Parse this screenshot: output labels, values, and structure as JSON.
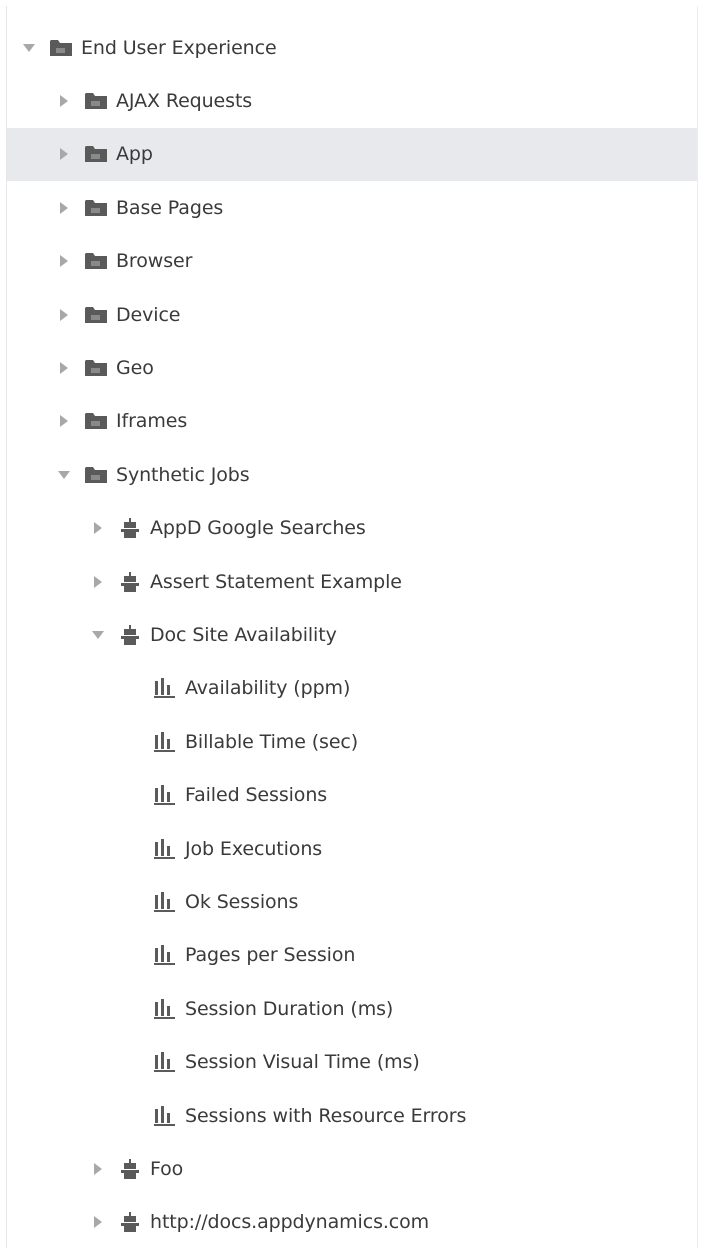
{
  "tree": {
    "root": {
      "label": "End User Experience",
      "expanded": true,
      "icon": "folder-icon"
    },
    "folders": [
      {
        "label": "AJAX Requests",
        "expanded": false,
        "selected": false,
        "icon": "folder-icon"
      },
      {
        "label": "App",
        "expanded": false,
        "selected": true,
        "icon": "folder-icon"
      },
      {
        "label": "Base Pages",
        "expanded": false,
        "selected": false,
        "icon": "folder-icon"
      },
      {
        "label": "Browser",
        "expanded": false,
        "selected": false,
        "icon": "folder-icon"
      },
      {
        "label": "Device",
        "expanded": false,
        "selected": false,
        "icon": "folder-icon"
      },
      {
        "label": "Geo",
        "expanded": false,
        "selected": false,
        "icon": "folder-icon"
      },
      {
        "label": "Iframes",
        "expanded": false,
        "selected": false,
        "icon": "folder-icon"
      },
      {
        "label": "Synthetic Jobs",
        "expanded": true,
        "selected": false,
        "icon": "folder-icon"
      }
    ],
    "jobs": [
      {
        "label": "AppD Google Searches",
        "expanded": false,
        "icon": "robot-icon"
      },
      {
        "label": "Assert Statement Example",
        "expanded": false,
        "icon": "robot-icon"
      },
      {
        "label": "Doc Site Availability",
        "expanded": true,
        "icon": "robot-icon"
      }
    ],
    "metrics": [
      {
        "label": "Availability (ppm)",
        "icon": "bar-chart-icon"
      },
      {
        "label": "Billable Time (sec)",
        "icon": "bar-chart-icon"
      },
      {
        "label": "Failed Sessions",
        "icon": "bar-chart-icon"
      },
      {
        "label": "Job Executions",
        "icon": "bar-chart-icon"
      },
      {
        "label": "Ok Sessions",
        "icon": "bar-chart-icon"
      },
      {
        "label": "Pages per Session",
        "icon": "bar-chart-icon"
      },
      {
        "label": "Session Duration (ms)",
        "icon": "bar-chart-icon"
      },
      {
        "label": "Session Visual Time (ms)",
        "icon": "bar-chart-icon"
      },
      {
        "label": "Sessions with Resource Errors",
        "icon": "bar-chart-icon"
      }
    ],
    "more_jobs": [
      {
        "label": "Foo",
        "expanded": false,
        "icon": "robot-icon"
      },
      {
        "label": "http://docs.appdynamics.com",
        "expanded": false,
        "icon": "robot-icon"
      }
    ]
  },
  "colors": {
    "text": "#3a3a3a",
    "icon": "#5a5a5a",
    "toggle": "#a8a8a8",
    "selected_row": "#e8e9ec"
  }
}
